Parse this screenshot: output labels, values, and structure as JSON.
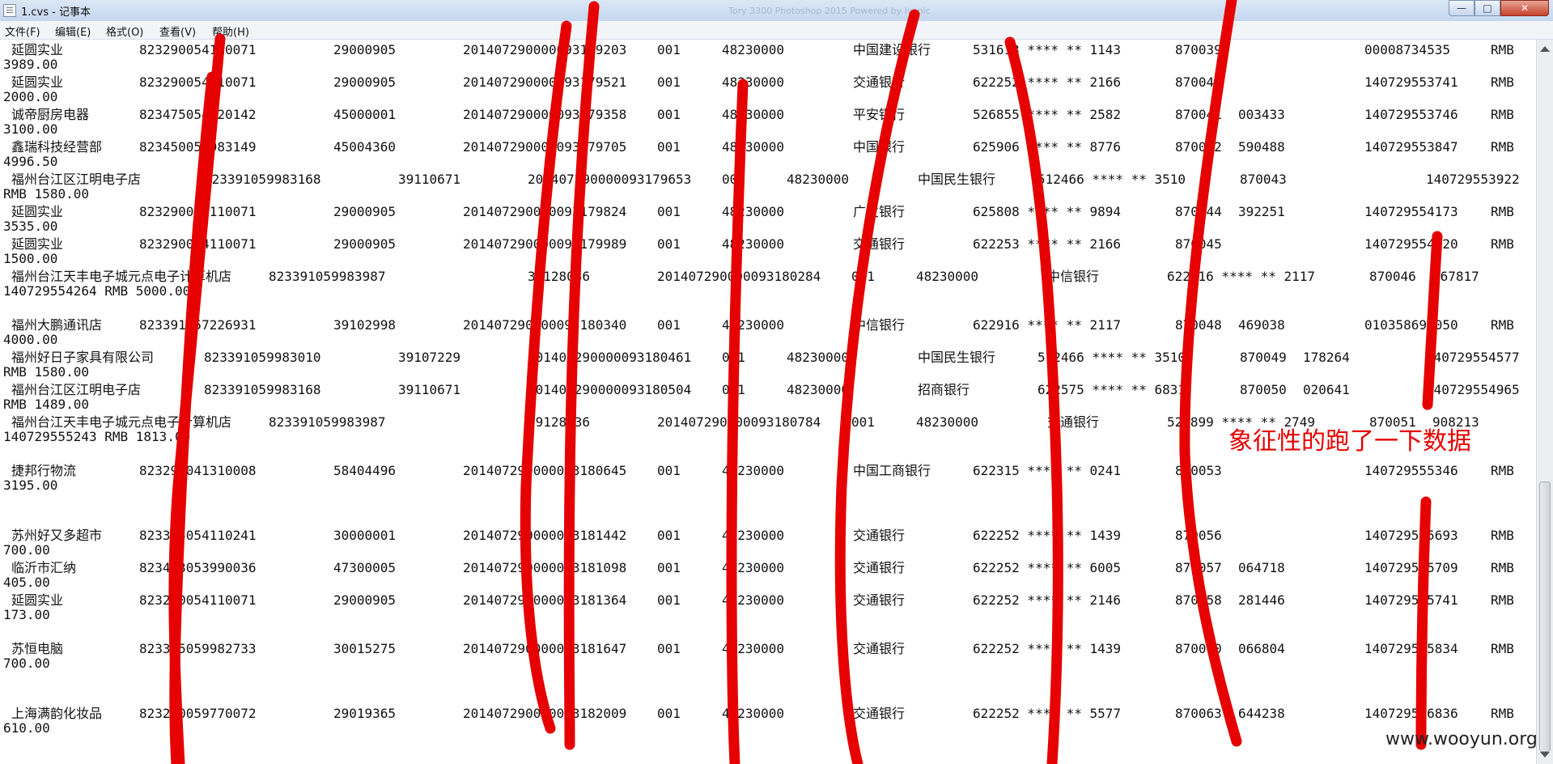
{
  "window": {
    "title": "1.cvs - 记事本",
    "background_title": "Tory 3300 Photoshop 2015 Powered by Iconic",
    "buttons": {
      "minimize": "—",
      "maximize": "□",
      "close": "✕"
    }
  },
  "menu": [
    "文件(F)",
    "编辑(E)",
    "格式(O)",
    "查看(V)",
    "帮助(H)"
  ],
  "records": [
    {
      "name": "延圆实业",
      "c1": "823290054110071",
      "c2": "29000905",
      "c3": "201407290000093179203",
      "c4": "001",
      "c5": "48230000",
      "bank": "中国建设银行",
      "card": "531613 **** ** 1143",
      "c8": "870039",
      "c9": "",
      "c10": "00008734535",
      "cur": "RMB",
      "amount": "3989.00"
    },
    {
      "name": "延圆实业",
      "c1": "823290054110071",
      "c2": "29000905",
      "c3": "201407290000093179521",
      "c4": "001",
      "c5": "48230000",
      "bank": "交通银行",
      "card": "622252 **** ** 2166",
      "c8": "870040",
      "c9": "",
      "c10": "140729553741",
      "cur": "RMB",
      "amount": "2000.00"
    },
    {
      "name": "诚帝厨房电器",
      "c1": "823475054220142",
      "c2": "45000001",
      "c3": "201407290000093179358",
      "c4": "001",
      "c5": "48230000",
      "bank": "平安银行",
      "card": "526855 **** ** 2582",
      "c8": "870041",
      "c9": "003433",
      "c10": "140729553746",
      "cur": "RMB",
      "amount": "3100.00"
    },
    {
      "name": "鑫瑞科技经营部",
      "c1": "823450059983149",
      "c2": "45004360",
      "c3": "201407290000093179705",
      "c4": "001",
      "c5": "48230000",
      "bank": "中国银行",
      "card": "625906 **** ** 8776",
      "c8": "870042",
      "c9": "590488",
      "c10": "140729553847",
      "cur": "RMB",
      "amount": "4996.50"
    },
    {
      "name": "福州台江区江明电子店",
      "c1": "823391059983168",
      "c2": "39110671",
      "c3": "201407290000093179653",
      "c4": "001",
      "c5": "48230000",
      "bank": "中国民生银行",
      "card": "512466 **** ** 3510",
      "c8": "870043",
      "c9": "",
      "c10": "140729553922",
      "cur": "RMB",
      "amount": "1580.00"
    },
    {
      "name": "延圆实业",
      "c1": "823290054110071",
      "c2": "29000905",
      "c3": "201407290000093179824",
      "c4": "001",
      "c5": "48230000",
      "bank": "广发银行",
      "card": "625808 **** ** 9894",
      "c8": "870044",
      "c9": "392251",
      "c10": "140729554173",
      "cur": "RMB",
      "amount": "3535.00"
    },
    {
      "name": "延圆实业",
      "c1": "823290054110071",
      "c2": "29000905",
      "c3": "201407290000093179989",
      "c4": "001",
      "c5": "48230000",
      "bank": "交通银行",
      "card": "622253 **** ** 2166",
      "c8": "870045",
      "c9": "",
      "c10": "140729554220",
      "cur": "RMB",
      "amount": "1500.00"
    },
    {
      "name": "福州台江天丰电子城元点电子计算机店",
      "c1": "823391059983987",
      "c2": "39128036",
      "c3": "201407290000093180284",
      "c4": "001",
      "c5": "48230000",
      "bank": "中信银行",
      "card": "622916 **** ** 2117",
      "c8": "870046",
      "c9": "467817",
      "c10": "140729554264",
      "cur": "RMB",
      "amount": "5000.00"
    },
    {
      "name": "福州大鹏通讯店",
      "c1": "823391057226931",
      "c2": "39102998",
      "c3": "201407290000093180340",
      "c4": "001",
      "c5": "48230000",
      "bank": "中信银行",
      "card": "622916 **** ** 2117",
      "c8": "870048",
      "c9": "469038",
      "c10": "010358693050",
      "cur": "RMB",
      "amount": "4000.00"
    },
    {
      "name": "福州好日子家具有限公司",
      "c1": "823391059983010",
      "c2": "39107229",
      "c3": "201407290000093180461",
      "c4": "001",
      "c5": "48230000",
      "bank": "中国民生银行",
      "card": "512466 **** ** 3510",
      "c8": "870049",
      "c9": "178264",
      "c10": "140729554577",
      "cur": "RMB",
      "amount": "1580.00"
    },
    {
      "name": "福州台江区江明电子店",
      "c1": "823391059983168",
      "c2": "39110671",
      "c3": "201407290000093180504",
      "c4": "001",
      "c5": "48230000",
      "bank": "招商银行",
      "card": "622575 **** ** 6831",
      "c8": "870050",
      "c9": "020641",
      "c10": "140729554965",
      "cur": "RMB",
      "amount": "1489.00"
    },
    {
      "name": "福州台江天丰电子城元点电子计算机店",
      "c1": "823391059983987",
      "c2": "39128036",
      "c3": "201407290000093180784",
      "c4": "001",
      "c5": "48230000",
      "bank": "交通银行",
      "card": "521899 **** ** 2749",
      "c8": "870051",
      "c9": "908213",
      "c10": "140729555243",
      "cur": "RMB",
      "amount": "1813.00"
    },
    {
      "name": "捷邦行物流",
      "c1": "823290041310008",
      "c2": "58404496",
      "c3": "201407290000093180645",
      "c4": "001",
      "c5": "48230000",
      "bank": "中国工商银行",
      "card": "622315 **** ** 0241",
      "c8": "870053",
      "c9": "",
      "c10": "140729555346",
      "cur": "RMB",
      "amount": "3195.00"
    },
    {
      "name": "苏州好又多超市",
      "c1": "823305054110241",
      "c2": "30000001",
      "c3": "201407290000093181442",
      "c4": "001",
      "c5": "48230000",
      "bank": "交通银行",
      "card": "622252 **** ** 1439",
      "c8": "870056",
      "c9": "",
      "c10": "140729555693",
      "cur": "RMB",
      "amount": "700.00"
    },
    {
      "name": "临沂市汇纳",
      "c1": "823473053990036",
      "c2": "47300005",
      "c3": "201407290000093181098",
      "c4": "001",
      "c5": "48230000",
      "bank": "交通银行",
      "card": "622252 **** ** 6005",
      "c8": "870057",
      "c9": "064718",
      "c10": "140729555709",
      "cur": "RMB",
      "amount": "405.00"
    },
    {
      "name": "延圆实业",
      "c1": "823290054110071",
      "c2": "29000905",
      "c3": "201407290000093181364",
      "c4": "001",
      "c5": "48230000",
      "bank": "交通银行",
      "card": "622252 **** ** 2146",
      "c8": "870058",
      "c9": "281446",
      "c10": "140729555741",
      "cur": "RMB",
      "amount": "173.00"
    },
    {
      "name": "苏恒电脑",
      "c1": "823305059982733",
      "c2": "30015275",
      "c3": "201407290000093181647",
      "c4": "001",
      "c5": "48230000",
      "bank": "交通银行",
      "card": "622252 **** ** 1439",
      "c8": "870060",
      "c9": "066804",
      "c10": "140729555834",
      "cur": "RMB",
      "amount": "700.00"
    },
    {
      "name": "上海满韵化妆品",
      "c1": "823290059770072",
      "c2": "29019365",
      "c3": "201407290000093182009",
      "c4": "001",
      "c5": "48230000",
      "bank": "交通银行",
      "card": "622252 **** ** 5577",
      "c8": "870063",
      "c9": "644238",
      "c10": "140729556836",
      "cur": "RMB",
      "amount": "610.00"
    }
  ],
  "annotation": {
    "note": "象征性的跑了一下数据",
    "color": "#e60000"
  },
  "watermark": "www.wooyun.org"
}
